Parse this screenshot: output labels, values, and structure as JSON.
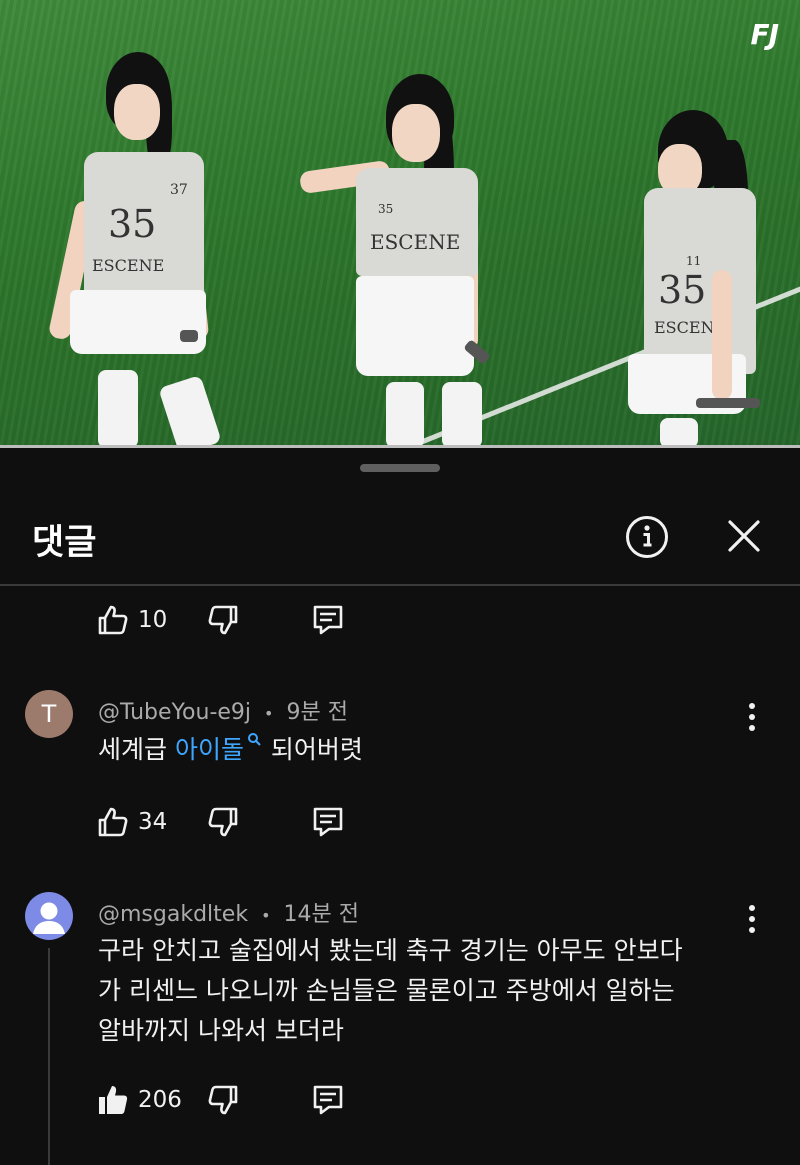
{
  "video": {
    "logo_text": "FJ",
    "performers": [
      {
        "shirt_number": "37",
        "shirt_logo": "35",
        "shirt_text": "ESCENE"
      },
      {
        "shirt_number": "35",
        "shirt_logo": "",
        "shirt_text": "ESCENE"
      },
      {
        "shirt_number": "11",
        "shirt_logo": "35",
        "shirt_text": "ESCENE"
      }
    ]
  },
  "panel": {
    "title": "댓글",
    "info_icon": "info-circle-icon",
    "close_icon": "close-icon"
  },
  "top_actions": {
    "like_count": "10"
  },
  "comments": [
    {
      "avatar_letter": "T",
      "avatar_color": "#9c7b6d",
      "author": "@TubeYou-e9j",
      "separator": "•",
      "time": "9분 전",
      "text_before": "세계급 ",
      "keyword": "아이돌",
      "text_after": " 되어버렷",
      "like_count": "34",
      "liked": false
    },
    {
      "avatar_color": "#7d8ae6",
      "author": "@msgakdltek",
      "separator": "•",
      "time": "14분 전",
      "lines": [
        "구라 안치고 술집에서 봤는데 축구 경기는 아무도 안보다",
        "가 리센느 나오니까 손님들은 물론이고 주방에서 일하는",
        "알바까지 나와서 보더라"
      ],
      "like_count": "206",
      "liked": true
    }
  ]
}
